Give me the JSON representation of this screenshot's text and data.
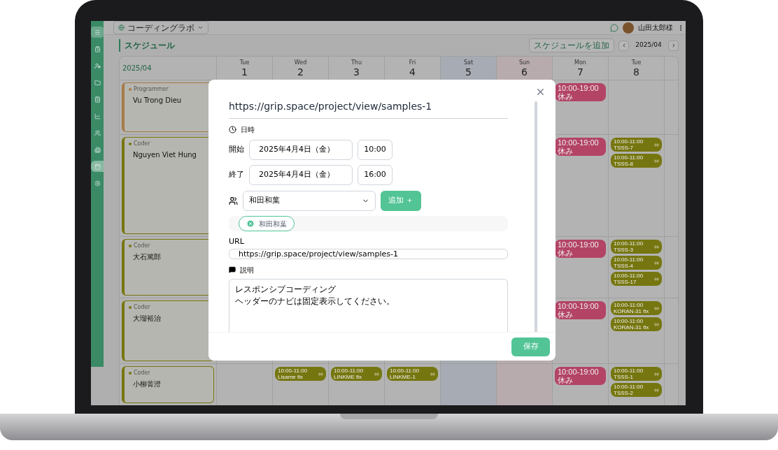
{
  "org_selector": {
    "label": "コーディングラボ"
  },
  "user": {
    "name": "山田太郎様"
  },
  "sidebar": {
    "items": [
      {
        "selected": false
      },
      {
        "selected": false
      },
      {
        "selected": false
      },
      {
        "selected": false
      },
      {
        "selected": false
      },
      {
        "selected": false
      },
      {
        "selected": false
      },
      {
        "selected": false
      },
      {
        "selected": true
      },
      {
        "selected": false
      }
    ]
  },
  "page_title": "スケジュール",
  "add_button": "スケジュールを追加",
  "month_nav": {
    "label": "2025/04"
  },
  "calendar": {
    "month_label": "2025/04",
    "days": [
      {
        "weekday": "Tue",
        "date": "1",
        "kind": "weekday"
      },
      {
        "weekday": "Wed",
        "date": "2",
        "kind": "weekday"
      },
      {
        "weekday": "Thu",
        "date": "3",
        "kind": "weekday"
      },
      {
        "weekday": "Fri",
        "date": "4",
        "kind": "weekday"
      },
      {
        "weekday": "Sat",
        "date": "5",
        "kind": "saturday"
      },
      {
        "weekday": "Sun",
        "date": "6",
        "kind": "sunday"
      },
      {
        "weekday": "Mon",
        "date": "7",
        "kind": "weekday"
      },
      {
        "weekday": "Tue",
        "date": "8",
        "kind": "weekday"
      }
    ],
    "rows": [
      {
        "role": "Programmer",
        "name": "Vu Trong Dieu",
        "color": "#a87a48",
        "cells": [
          [],
          [],
          [],
          [],
          [],
          [],
          [
            {
              "kind": "leave",
              "text": "10:00-19:00 休み",
              "color": "#b34466",
              "link": false
            }
          ],
          []
        ]
      },
      {
        "role": "Coder",
        "name": "Nguyen Viet Hung",
        "color": "#767610",
        "cells": [
          [],
          [],
          [],
          [],
          [],
          [],
          [
            {
              "kind": "leave",
              "text": "10:00-19:00 休み",
              "color": "#b34466",
              "link": false
            }
          ],
          [
            {
              "kind": "task",
              "text": "10:00-11:00 TSSS-7",
              "color": "#767610",
              "link": true
            },
            {
              "kind": "task",
              "text": "10:00-11:00 TSSS-8",
              "color": "#767610",
              "link": true
            }
          ]
        ]
      },
      {
        "role": "Coder",
        "name": "大石篤郎",
        "color": "#767610",
        "cells": [
          [],
          [],
          [],
          [],
          [],
          [],
          [
            {
              "kind": "leave",
              "text": "10:00-19:00 休み",
              "color": "#b34466",
              "link": false
            }
          ],
          [
            {
              "kind": "task",
              "text": "10:00-11:00 TSSS-3",
              "color": "#767610",
              "link": true
            },
            {
              "kind": "task",
              "text": "10:00-11:00 TSSS-4",
              "color": "#767610",
              "link": true
            },
            {
              "kind": "task",
              "text": "10:00-11:00 TSSS-17",
              "color": "#767610",
              "link": true
            }
          ]
        ]
      },
      {
        "role": "Coder",
        "name": "大瑠裕治",
        "color": "#767610",
        "cells": [
          [],
          [],
          [],
          [],
          [],
          [],
          [
            {
              "kind": "leave",
              "text": "10:00-19:00 休み",
              "color": "#b34466",
              "link": false
            }
          ],
          [
            {
              "kind": "task",
              "text": "10:00-11:00 KORAN-31 fix",
              "color": "#767610",
              "link": true
            },
            {
              "kind": "task",
              "text": "10:00-11:00 KORAN-31 fix",
              "color": "#767610",
              "link": true
            }
          ]
        ]
      },
      {
        "role": "Coder",
        "name": "小柳菁澄",
        "color": "#767610",
        "cells": [
          [],
          [
            {
              "kind": "task",
              "text": "10:00-11:00 Lisame fix",
              "color": "#767610",
              "link": true
            }
          ],
          [
            {
              "kind": "task",
              "text": "10:00-11:00 LINKME fix",
              "color": "#767610",
              "link": true
            }
          ],
          [
            {
              "kind": "task",
              "text": "10:00-11:00 LINKME-1",
              "color": "#767610",
              "link": true
            }
          ],
          [],
          [],
          [
            {
              "kind": "leave",
              "text": "10:00-19:00 休み",
              "color": "#b34466",
              "link": false
            }
          ],
          [
            {
              "kind": "task",
              "text": "10:00-11:00 TSSS-1",
              "color": "#767610",
              "link": true
            },
            {
              "kind": "task",
              "text": "10:00-11:00 TSSS-2",
              "color": "#767610",
              "link": true
            }
          ]
        ]
      }
    ]
  },
  "modal": {
    "title": "https://grip.space/project/view/samples-1",
    "datetime_label": "日時",
    "start": {
      "label": "開始",
      "date": "2025年4月4日（金）",
      "time": "10:00"
    },
    "end": {
      "label": "終了",
      "date": "2025年4月4日（金）",
      "time": "16:00"
    },
    "member_select": {
      "value": "和田和葉"
    },
    "add_member_button": "追加 ＋",
    "members": [
      {
        "name": "和田和葉"
      }
    ],
    "url_label": "URL",
    "url_value": "https://grip.space/project/view/samples-1",
    "description_label": "説明",
    "description_lines": [
      "レスポンシブコーディング",
      "ヘッダーのナビは固定表示してください。"
    ],
    "save_button": "保存"
  }
}
